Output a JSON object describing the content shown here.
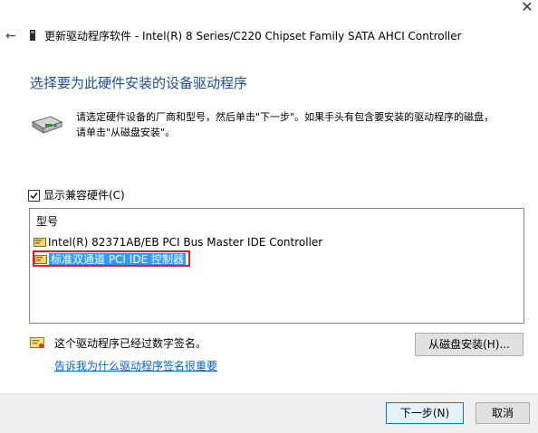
{
  "window": {
    "close_glyph": "✕",
    "back_glyph": "←",
    "title": "更新驱动程序软件 - Intel(R) 8 Series/C220 Chipset Family SATA AHCI Controller"
  },
  "heading": "选择要为此硬件安装的设备驱动程序",
  "intro": {
    "line1": "请选定硬件设备的厂商和型号，然后单击\"下一步\"。如果手头有包含要安装的驱动程序的磁盘，",
    "line2": "请单击\"从磁盘安装\"。"
  },
  "show_compatible": {
    "label": "显示兼容硬件(C)",
    "checked": true
  },
  "model_list": {
    "header": "型号",
    "items": [
      {
        "label": "Intel(R) 82371AB/EB PCI Bus Master IDE Controller",
        "selected": false
      },
      {
        "label": "标准双通道 PCI IDE 控制器",
        "selected": true
      }
    ]
  },
  "signed_status": "这个驱动程序已经过数字签名。",
  "help_link": "告诉我为什么驱动程序签名很重要",
  "buttons": {
    "have_disk": "从磁盘安装(H)...",
    "next": "下一步(N)",
    "cancel": "取消"
  },
  "colors": {
    "heading": "#1f4e9a",
    "link": "#0066cc",
    "selection": "#3399ff",
    "highlight_frame": "#d9232a"
  },
  "icons": [
    "close-icon",
    "back-arrow-icon",
    "device-icon",
    "hardware-icon",
    "checkbox-check-icon",
    "driver-icon",
    "certificate-icon"
  ]
}
